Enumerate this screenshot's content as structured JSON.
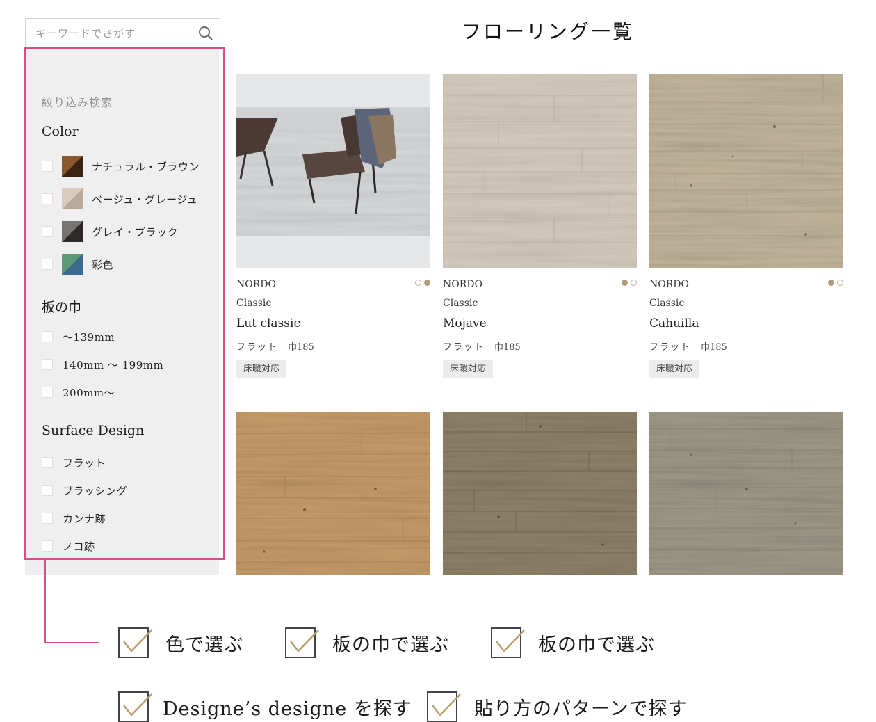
{
  "search": {
    "placeholder": "キーワードでさがす",
    "icon": "search-icon"
  },
  "sidebar": {
    "title": "絞り込み検索",
    "color": {
      "title": "Color",
      "options": [
        {
          "label": "ナチュラル・ブラウン",
          "colors": [
            "#8a5a2e",
            "#3a2414"
          ]
        },
        {
          "label": "ベージュ・グレージュ",
          "colors": [
            "#d9cbbd",
            "#b8aa9c"
          ]
        },
        {
          "label": "グレイ・ブラック",
          "colors": [
            "#777370",
            "#2f2a27"
          ]
        },
        {
          "label": "彩色",
          "colors": [
            "#5a9a75",
            "#3c6a8a"
          ]
        }
      ]
    },
    "width": {
      "title": "板の巾",
      "options": [
        "～139mm",
        "140mm ～ 199mm",
        "200mm～"
      ]
    },
    "surface": {
      "title": "Surface Design",
      "options": [
        "フラット",
        "ブラッシング",
        "カンナ跡",
        "ノコ跡"
      ]
    }
  },
  "main": {
    "title": "フローリング一覧",
    "products": [
      {
        "brand": "NORDO",
        "series": "Classic",
        "name": "Lut classic",
        "surface": "フラット",
        "width": "巾185",
        "tag": "床暖対応",
        "active_dot": 1
      },
      {
        "brand": "NORDO",
        "series": "Classic",
        "name": "Mojave",
        "surface": "フラット",
        "width": "巾185",
        "tag": "床暖対応",
        "active_dot": 0
      },
      {
        "brand": "NORDO",
        "series": "Classic",
        "name": "Cahuilla",
        "surface": "フラット",
        "width": "巾185",
        "tag": "床暖対応",
        "active_dot": 0
      }
    ]
  },
  "features": [
    "色で選ぶ",
    "板の巾で選ぶ",
    "板の巾で選ぶ",
    "Designe’s designe を探す",
    "貼り方のパターンで探す"
  ],
  "colors": {
    "accent_highlight": "#d94e86",
    "check_gold": "#b5a06c",
    "dot_active": "#b09d77"
  }
}
